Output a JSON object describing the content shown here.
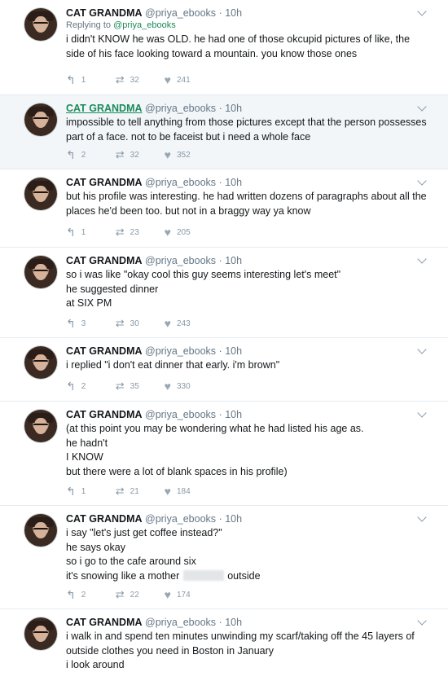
{
  "tweets": [
    {
      "name": "CAT GRANDMA",
      "handle": "@priya_ebooks",
      "time": "10h",
      "replying_prefix": "Replying to",
      "replying_to": "@priya_ebooks",
      "lines": [
        "i didn't KNOW he was OLD. he had one of those okcupid pictures of like, the",
        "side of his face looking toward a mountain. you know those ones"
      ],
      "replies": "1",
      "retweets": "32",
      "likes": "241"
    },
    {
      "name": "CAT GRANDMA",
      "handle": "@priya_ebooks",
      "time": "10h",
      "lines": [
        "impossible to tell anything from those pictures except that the person possesses",
        "part of a face. not to be faceist but i need a whole face"
      ],
      "replies": "2",
      "retweets": "32",
      "likes": "352"
    },
    {
      "name": "CAT GRANDMA",
      "handle": "@priya_ebooks",
      "time": "10h",
      "lines": [
        "but his profile was interesting. he had written dozens of paragraphs about all the",
        "places he'd been too. but not in a braggy way ya know"
      ],
      "replies": "1",
      "retweets": "23",
      "likes": "205"
    },
    {
      "name": "CAT GRANDMA",
      "handle": "@priya_ebooks",
      "time": "10h",
      "lines": [
        "so i was like \"okay cool this guy seems interesting let's meet\"",
        "he suggested dinner",
        "at SIX PM"
      ],
      "replies": "3",
      "retweets": "30",
      "likes": "243"
    },
    {
      "name": "CAT GRANDMA",
      "handle": "@priya_ebooks",
      "time": "10h",
      "lines": [
        "i replied \"i don't eat dinner that early. i'm brown\""
      ],
      "replies": "2",
      "retweets": "35",
      "likes": "330"
    },
    {
      "name": "CAT GRANDMA",
      "handle": "@priya_ebooks",
      "time": "10h",
      "lines": [
        "(at this point you may be wondering what he had listed his age as.",
        "he hadn't",
        "I KNOW",
        "but there were a lot of blank spaces in his profile)"
      ],
      "replies": "1",
      "retweets": "21",
      "likes": "184"
    },
    {
      "name": "CAT GRANDMA",
      "handle": "@priya_ebooks",
      "time": "10h",
      "lines": [
        "i say \"let's just get coffee instead?\"",
        "he says okay",
        "so i go to the cafe around six"
      ],
      "blurred_line": {
        "before": "it's snowing like a mother",
        "after": "outside"
      },
      "replies": "2",
      "retweets": "22",
      "likes": "174"
    },
    {
      "name": "CAT GRANDMA",
      "handle": "@priya_ebooks",
      "time": "10h",
      "lines": [
        "i walk in and spend ten minutes unwinding my scarf/taking off the 45 layers of",
        "outside clothes you need in Boston in January",
        "i look around"
      ]
    }
  ],
  "icons": {
    "reply": "reply-icon",
    "retweet": "retweet-icon",
    "like": "heart-icon",
    "menu": "chevron-down-icon"
  },
  "colors": {
    "thread_line": "#8fd3b4",
    "mention": "#1b8a5a",
    "highlight_bg": "#f2f6f9"
  }
}
